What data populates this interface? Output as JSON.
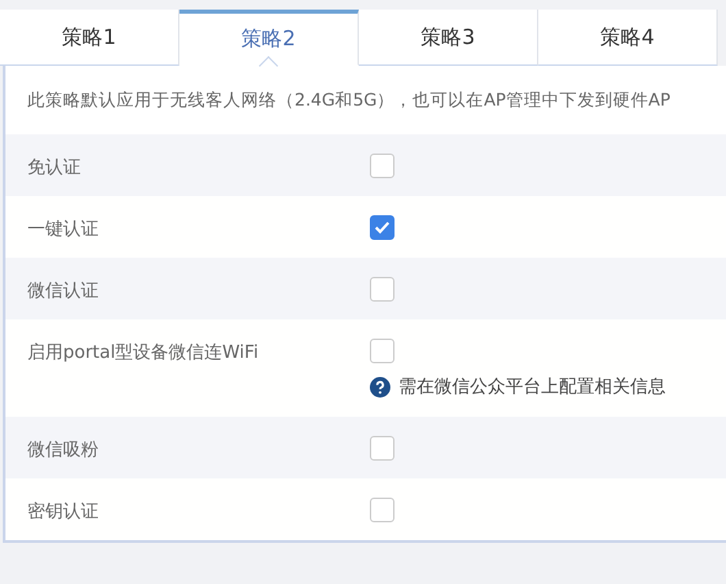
{
  "tabs": [
    {
      "label": "策略1",
      "selected": false
    },
    {
      "label": "策略2",
      "selected": true
    },
    {
      "label": "策略3",
      "selected": false
    },
    {
      "label": "策略4",
      "selected": false
    }
  ],
  "description": "此策略默认应用于无线客人网络（2.4G和5G），也可以在AP管理中下发到硬件AP",
  "options": [
    {
      "label": "免认证",
      "checked": false
    },
    {
      "label": "一键认证",
      "checked": true
    },
    {
      "label": "微信认证",
      "checked": false
    },
    {
      "label": "启用portal型设备微信连WiFi",
      "checked": false,
      "hint": "需在微信公众平台上配置相关信息"
    },
    {
      "label": "微信吸粉",
      "checked": false
    },
    {
      "label": "密钥认证",
      "checked": false
    }
  ]
}
